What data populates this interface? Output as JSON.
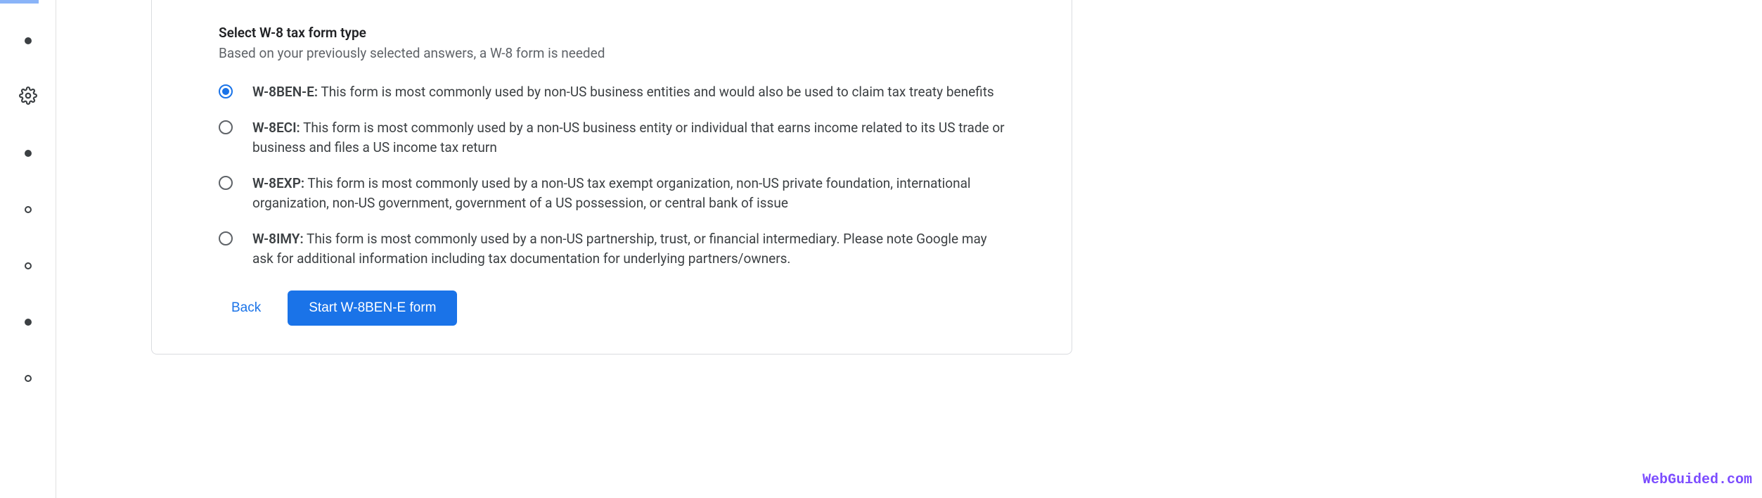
{
  "form": {
    "title": "Select W-8 tax form type",
    "subtitle": "Based on your previously selected answers, a W-8 form is needed",
    "options": [
      {
        "name": "W-8BEN-E:",
        "description": " This form is most commonly used by non-US business entities and would also be used to claim tax treaty benefits",
        "selected": true
      },
      {
        "name": "W-8ECI:",
        "description": " This form is most commonly used by a non-US business entity or individual that earns income related to its US trade or business and files a US income tax return",
        "selected": false
      },
      {
        "name": "W-8EXP:",
        "description": " This form is most commonly used by a non-US tax exempt organization, non-US private foundation, international organization, non-US government, government of a US possession, or central bank of issue",
        "selected": false
      },
      {
        "name": "W-8IMY:",
        "description": " This form is most commonly used by a non-US partnership, trust, or financial intermediary. Please note Google may ask for additional information including tax documentation for underlying partners/owners.",
        "selected": false
      }
    ],
    "back_label": "Back",
    "start_label": "Start W-8BEN-E form"
  },
  "watermark": "WebGuided.com"
}
